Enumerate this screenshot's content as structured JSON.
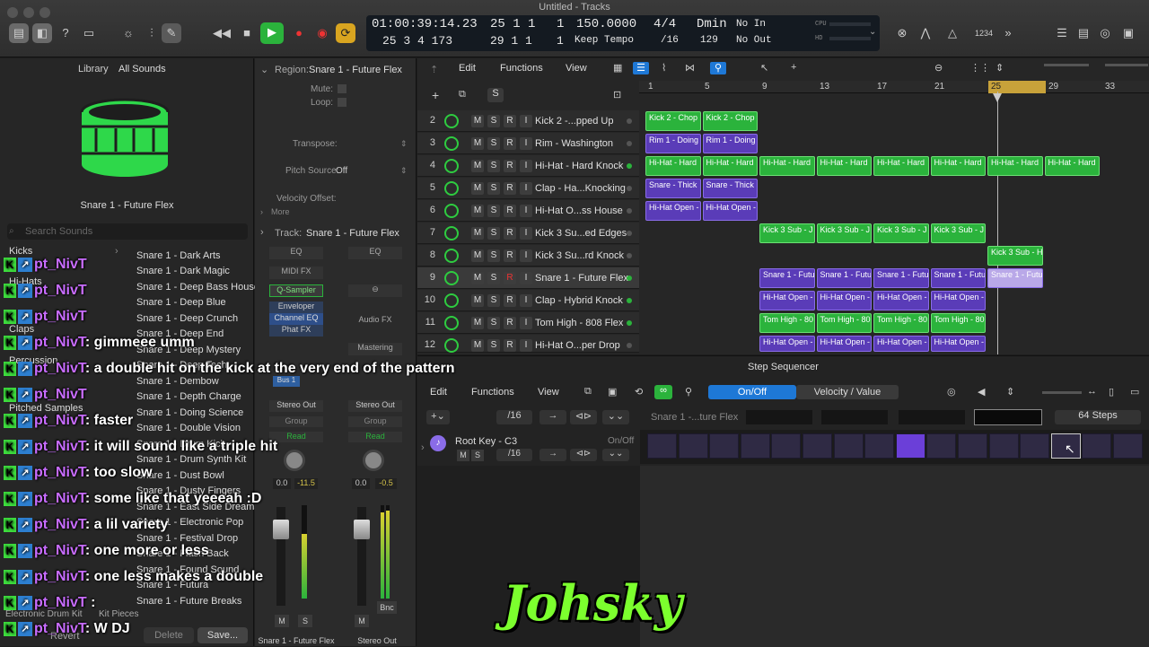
{
  "window": {
    "title": "Untitled - Tracks"
  },
  "lcd": {
    "time": "01:00:39:14.23",
    "bars": "25 1 1",
    "bars_sub": "1",
    "tempo": "150.0000",
    "sig": "4/4",
    "key": "Dmin",
    "in": "No In",
    "time2": "25 3 4 173",
    "bars2": "29 1 1",
    "bars2_sub": "1",
    "tempo_mode": "Keep Tempo",
    "div": "/16",
    "bpm2": "129",
    "out": "No Out"
  },
  "toolbar": {
    "count_in": "1234"
  },
  "library": {
    "title": "Library",
    "filter": "All Sounds",
    "preset_name": "Snare 1 - Future Flex",
    "search_placeholder": "Search Sounds",
    "categories": [
      "Kicks",
      "Hi-Hats",
      "Claps",
      "Percussion",
      "Pitched Samples"
    ],
    "items": [
      "Snare 1 - Dark Arts",
      "Snare 1 - Dark Magic",
      "Snare 1 - Deep Bass House",
      "Snare 1 - Deep Blue",
      "Snare 1 - Deep Crunch",
      "Snare 1 - Deep End",
      "Snare 1 - Deep Mystery",
      "Snare 1 - Deep Tech",
      "Snare 1 - Dembow",
      "Snare 1 - Depth Charge",
      "Snare 1 - Doing Science",
      "Snare 1 - Double Vision",
      "Snare 1 - Drum Kick",
      "Snare 1 - Drum Synth Kit",
      "Snare 1 - Dust Bowl",
      "Snare 1 - Dusty Fingers",
      "Snare 1 - East Side Dreams",
      "Snare 1 - Electronic Pop",
      "Snare 1 - Festival Drop",
      "Snare 1 - Flash Back",
      "Snare 1 - Found Sound",
      "Snare 1 - Futura",
      "Snare 1 - Future Breaks"
    ],
    "path": "Electronic Drum Kit",
    "path2": "Kit Pieces",
    "revert": "Revert",
    "delete": "Delete",
    "save": "Save..."
  },
  "inspector": {
    "region_label": "Region:",
    "region_name": "Snare 1 - Future Flex",
    "mute": "Mute:",
    "loop": "Loop:",
    "transpose": "Transpose:",
    "pitch_source": "Pitch Source:",
    "pitch_val": "Off",
    "velocity": "Velocity Offset:",
    "more": "More",
    "track_label": "Track:",
    "track_name": "Snare 1 - Future Flex",
    "ch1": {
      "eq": "EQ",
      "midifx": "MIDI FX",
      "inst": "Q-Sampler",
      "fx1": "Enveloper",
      "fx2": "Channel EQ",
      "fx3": "Phat FX",
      "send": "Bus 1",
      "out": "Stereo Out",
      "group": "Group",
      "read": "Read",
      "vol": "0.0",
      "peak": "-11.5",
      "name": "Snare 1 - Future Flex",
      "m": "M",
      "s": "S"
    },
    "ch2": {
      "eq": "EQ",
      "audiofx": "Audio FX",
      "mastering": "Mastering",
      "out": "Stereo Out",
      "group": "Group",
      "read": "Read",
      "vol": "0.0",
      "peak": "-0.5",
      "name": "Stereo Out",
      "m": "M",
      "bnc": "Bnc"
    }
  },
  "tracks_menu": {
    "edit": "Edit",
    "functions": "Functions",
    "view": "View"
  },
  "ruler": [
    "1",
    "5",
    "9",
    "13",
    "17",
    "21",
    "25",
    "29",
    "33"
  ],
  "tracks": [
    {
      "n": "2",
      "name": "Kick 2 -...pped Up"
    },
    {
      "n": "3",
      "name": "Rim - Washington"
    },
    {
      "n": "4",
      "name": "Hi-Hat - Hard Knock"
    },
    {
      "n": "5",
      "name": "Clap - Ha...Knocking"
    },
    {
      "n": "6",
      "name": "Hi-Hat O...ss House"
    },
    {
      "n": "7",
      "name": "Kick 3 Su...ed Edges"
    },
    {
      "n": "8",
      "name": "Kick 3 Su...rd Knock"
    },
    {
      "n": "9",
      "name": "Snare 1 - Future Flex"
    },
    {
      "n": "10",
      "name": "Clap - Hybrid Knock"
    },
    {
      "n": "11",
      "name": "Tom High - 808 Flex"
    },
    {
      "n": "12",
      "name": "Hi-Hat O...per Drop"
    }
  ],
  "regions": {
    "r2": "Kick 2 - Chop",
    "r3": "Rim 1 - Doing",
    "r4": "Hi-Hat - Hard",
    "r5": "Snare - Thick",
    "r6": "Hi-Hat Open -",
    "r7": "Kick 3 Sub - J",
    "r8": "Kick 3 Sub - H",
    "r9": "Snare 1 - Futur",
    "r9b": "Snare 1 - Futu",
    "r10": "Hi-Hat Open -",
    "r11": "Tom High - 80",
    "r12": "Hi-Hat Open -"
  },
  "stepseq": {
    "title": "Step Sequencer",
    "edit": "Edit",
    "functions": "Functions",
    "view": "View",
    "onoff": "On/Off",
    "velocity": "Velocity / Value",
    "res": "/16",
    "pattern": "Snare 1 -...ture Flex",
    "steps": "64 Steps",
    "row": "Root Key - C3",
    "row_onoff": "On/Off",
    "row_res": "/16",
    "m": "M",
    "s": "S"
  },
  "chat": [
    {
      "u": "pt_NivT",
      "t": ""
    },
    {
      "u": "pt_NivT",
      "t": ""
    },
    {
      "u": "pt_NivT",
      "t": ""
    },
    {
      "u": "pt_NivT",
      "t": ": gimmeee umm"
    },
    {
      "u": "pt_NivT",
      "t": ": a double hit on the kick at the very end of the pattern"
    },
    {
      "u": "pt_NivT",
      "t": ""
    },
    {
      "u": "pt_NivT",
      "t": ": faster"
    },
    {
      "u": "pt_NivT",
      "t": ": it will sound like a triple hit"
    },
    {
      "u": "pt_NivT",
      "t": ": too slow"
    },
    {
      "u": "pt_NivT",
      "t": ": some like that yeeeah :D"
    },
    {
      "u": "pt_NivT",
      "t": ": a lil variety"
    },
    {
      "u": "pt_NivT",
      "t": ": one more or less"
    },
    {
      "u": "pt_NivT",
      "t": ": one less makes a double"
    },
    {
      "u": "pt_NivT",
      "t": " :"
    },
    {
      "u": "pt_NivT",
      "t": ": W DJ"
    }
  ],
  "watermark": "Johsky",
  "colors": {
    "green": "#2bb33c",
    "purple": "#5a3cb8",
    "accent": "#1e78d6",
    "step_on": "#6b3fd8"
  }
}
